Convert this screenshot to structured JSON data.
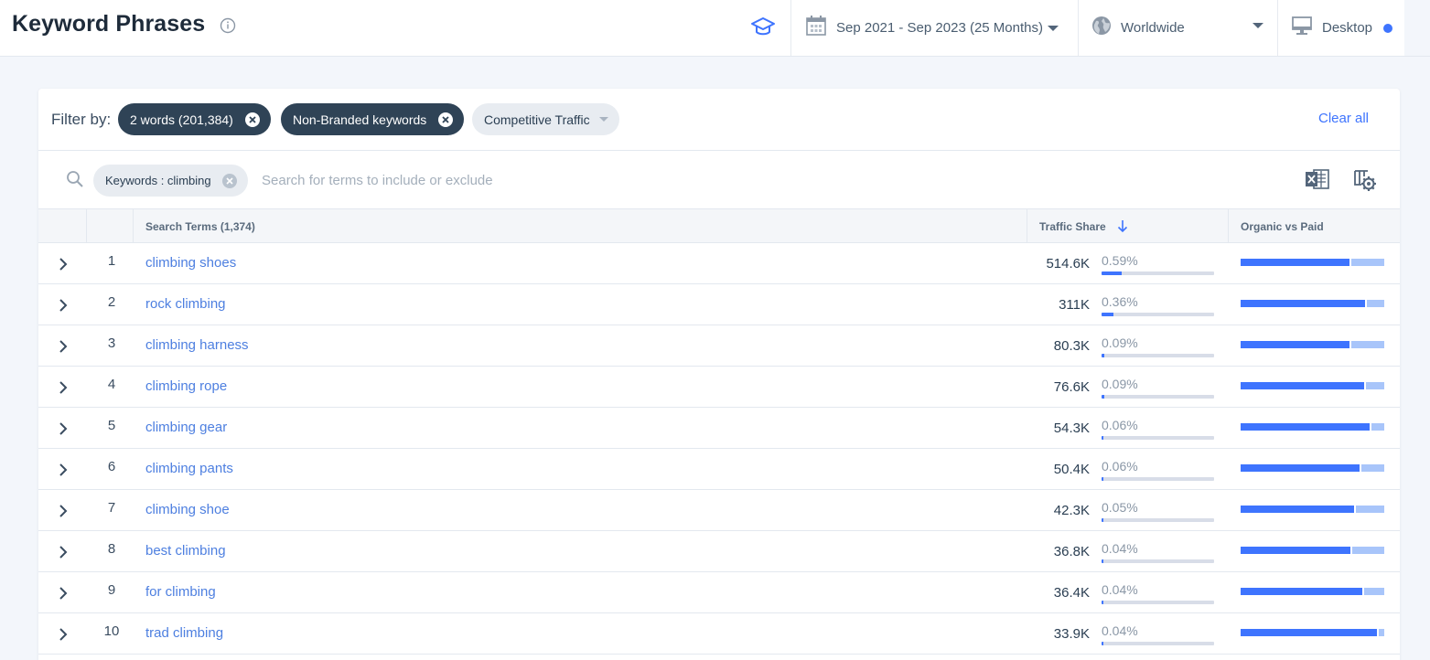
{
  "header": {
    "title": "Keyword Phrases",
    "date_range": "Sep 2021 - Sep 2023 (25 Months)",
    "country": "Worldwide",
    "device": "Desktop"
  },
  "filters": {
    "label": "Filter by:",
    "chips": [
      {
        "label": "2 words (201,384)"
      },
      {
        "label": "Non-Branded keywords"
      },
      {
        "label": "Competitive Traffic"
      }
    ],
    "clear_all": "Clear all"
  },
  "search": {
    "keyword_chip": "Keywords : climbing",
    "placeholder": "Search for terms to include or exclude"
  },
  "table": {
    "columns": {
      "terms": "Search Terms (1,374)",
      "traffic_share": "Traffic Share",
      "organic_vs_paid": "Organic vs Paid"
    },
    "rows": [
      {
        "rank": "1",
        "term": "climbing shoes",
        "traffic": "514.6K",
        "share_pct": "0.59%",
        "share_value": 0.59,
        "organic_ratio": 0.77
      },
      {
        "rank": "2",
        "term": "rock climbing",
        "traffic": "311K",
        "share_pct": "0.36%",
        "share_value": 0.36,
        "organic_ratio": 0.88
      },
      {
        "rank": "3",
        "term": "climbing harness",
        "traffic": "80.3K",
        "share_pct": "0.09%",
        "share_value": 0.09,
        "organic_ratio": 0.77
      },
      {
        "rank": "4",
        "term": "climbing rope",
        "traffic": "76.6K",
        "share_pct": "0.09%",
        "share_value": 0.09,
        "organic_ratio": 0.87
      },
      {
        "rank": "5",
        "term": "climbing gear",
        "traffic": "54.3K",
        "share_pct": "0.06%",
        "share_value": 0.06,
        "organic_ratio": 0.91
      },
      {
        "rank": "6",
        "term": "climbing pants",
        "traffic": "50.4K",
        "share_pct": "0.06%",
        "share_value": 0.06,
        "organic_ratio": 0.84
      },
      {
        "rank": "7",
        "term": "climbing shoe",
        "traffic": "42.3K",
        "share_pct": "0.05%",
        "share_value": 0.05,
        "organic_ratio": 0.8
      },
      {
        "rank": "8",
        "term": "best climbing",
        "traffic": "36.8K",
        "share_pct": "0.04%",
        "share_value": 0.04,
        "organic_ratio": 0.78
      },
      {
        "rank": "9",
        "term": "for climbing",
        "traffic": "36.4K",
        "share_pct": "0.04%",
        "share_value": 0.04,
        "organic_ratio": 0.86
      },
      {
        "rank": "10",
        "term": "trad climbing",
        "traffic": "33.9K",
        "share_pct": "0.04%",
        "share_value": 0.04,
        "organic_ratio": 0.96
      }
    ]
  },
  "colors": {
    "accent": "#3e74fe",
    "paid_bar": "#a8c5fa",
    "chip_dark": "#2f4356",
    "link": "#4d7fe0"
  }
}
